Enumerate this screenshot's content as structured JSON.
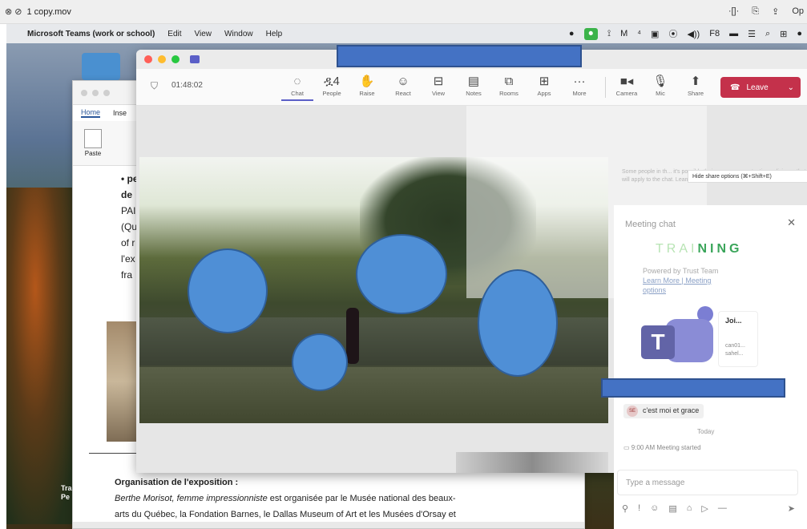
{
  "player": {
    "controls": "⊗ ⊘",
    "filename": "1 copy.mov",
    "right": [
      "·[]·",
      "⎘",
      "⇪",
      "Op"
    ]
  },
  "menubar": {
    "apple": "",
    "app": "Microsoft Teams (work or school)",
    "items": [
      "Edit",
      "View",
      "Window",
      "Help"
    ],
    "status": [
      "●",
      "⏺",
      "⟟",
      "M",
      "⁴",
      "▣",
      "⦿",
      "◀))",
      "F8",
      "▬",
      "☰",
      "⌕",
      "⊞",
      "●"
    ]
  },
  "desktop": {
    "label_lines": [
      "Tra",
      "Pe"
    ]
  },
  "word": {
    "tabs": [
      "Home",
      "Inse"
    ],
    "paste_label": "Paste",
    "body_lines": [
      "• pe",
      "de",
      "",
      "PAI",
      "(Qu",
      "of r",
      "l'ex",
      "fra"
    ],
    "section_title": "Organisation de l'exposition :",
    "section_line1_italic": "Berthe Morisot, femme impressionniste",
    "section_line1_rest": " est organisée par le Musée national des beaux-",
    "section_line2": "arts du Québec, la Fondation Barnes, le Dallas Museum of Art et les Musées d'Orsay et"
  },
  "teams": {
    "timer": "01:48:02",
    "tools": [
      {
        "label": "Chat",
        "glyph": "◌"
      },
      {
        "label": "People",
        "glyph": "ዷ4"
      },
      {
        "label": "Raise",
        "glyph": "✋"
      },
      {
        "label": "React",
        "glyph": "☺"
      },
      {
        "label": "View",
        "glyph": "⊟"
      },
      {
        "label": "Notes",
        "glyph": "▤"
      },
      {
        "label": "Rooms",
        "glyph": "⧉"
      },
      {
        "label": "Apps",
        "glyph": "⊞"
      },
      {
        "label": "More",
        "glyph": "···"
      },
      {
        "label": "Camera",
        "glyph": "■◂"
      },
      {
        "label": "Mic",
        "glyph": "🎙"
      },
      {
        "label": "Share",
        "glyph": "⬆"
      }
    ],
    "leave_label": "Leave",
    "leave_icon": "☎",
    "share_tooltip": "Hide share options (⌘+Shift+E)",
    "faint_note": "Some people in th... it's possible their ... message retention policies ... that will apply to the chat. Learn more",
    "chat": {
      "title": "Meeting chat",
      "close": "✕",
      "training_light": "TRAI",
      "training_bold": "NING",
      "powered": "Powered by Trust Team",
      "links": "Learn More | Meeting",
      "links2": "options",
      "card_name": "Joi...",
      "card_sub1": "can01...",
      "card_sub2": "sahel...",
      "message_avatar": "SE",
      "message": "c'est moi et grace",
      "day": "Today",
      "system_icon": "▭",
      "system_msg": "9:00 AM   Meeting started",
      "compose_placeholder": "Type a message",
      "compose_tools": [
        "⚲",
        "!",
        "☺",
        "▤",
        "⌂",
        "▷",
        "—",
        "➤"
      ]
    }
  },
  "colors": {
    "redaction": "#4472c4",
    "leave": "#c4314b",
    "teams_accent": "#5b5fc7"
  }
}
